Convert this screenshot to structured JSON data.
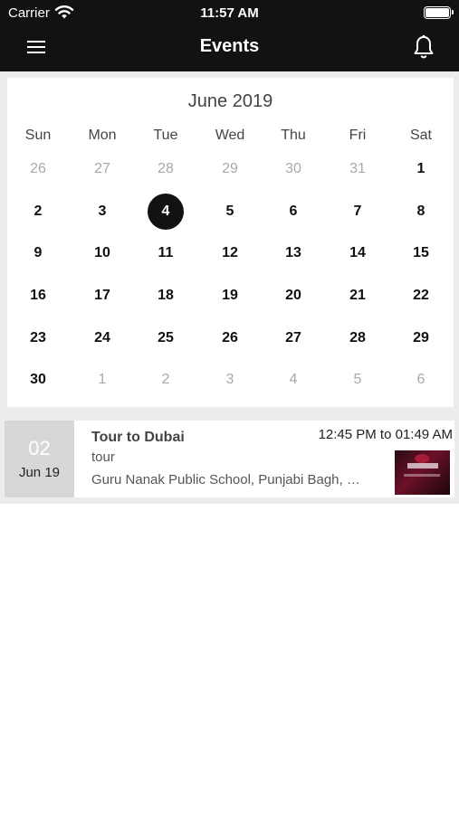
{
  "status_bar": {
    "carrier": "Carrier",
    "time": "11:57 AM"
  },
  "nav": {
    "title": "Events"
  },
  "calendar": {
    "month_title": "June 2019",
    "weekdays": [
      "Sun",
      "Mon",
      "Tue",
      "Wed",
      "Thu",
      "Fri",
      "Sat"
    ],
    "weeks": [
      [
        "26",
        "27",
        "28",
        "29",
        "30",
        "31",
        "1"
      ],
      [
        "2",
        "3",
        "4",
        "5",
        "6",
        "7",
        "8"
      ],
      [
        "9",
        "10",
        "11",
        "12",
        "13",
        "14",
        "15"
      ],
      [
        "16",
        "17",
        "18",
        "19",
        "20",
        "21",
        "22"
      ],
      [
        "23",
        "24",
        "25",
        "26",
        "27",
        "28",
        "29"
      ],
      [
        "30",
        "1",
        "2",
        "3",
        "4",
        "5",
        "6"
      ]
    ],
    "selected_day": "4"
  },
  "events": [
    {
      "day": "02",
      "month_year": "Jun 19",
      "title": "Tour to Dubai",
      "time": "12:45 PM to 01:49 AM",
      "category": "tour",
      "location": "Guru Nanak Public School, Punjabi Bagh, New Delhi"
    }
  ],
  "colors": {
    "header_bg": "#121212",
    "selected_day_bg": "#121212",
    "page_bg": "#ececec",
    "date_box_bg": "#d7d7d7"
  }
}
